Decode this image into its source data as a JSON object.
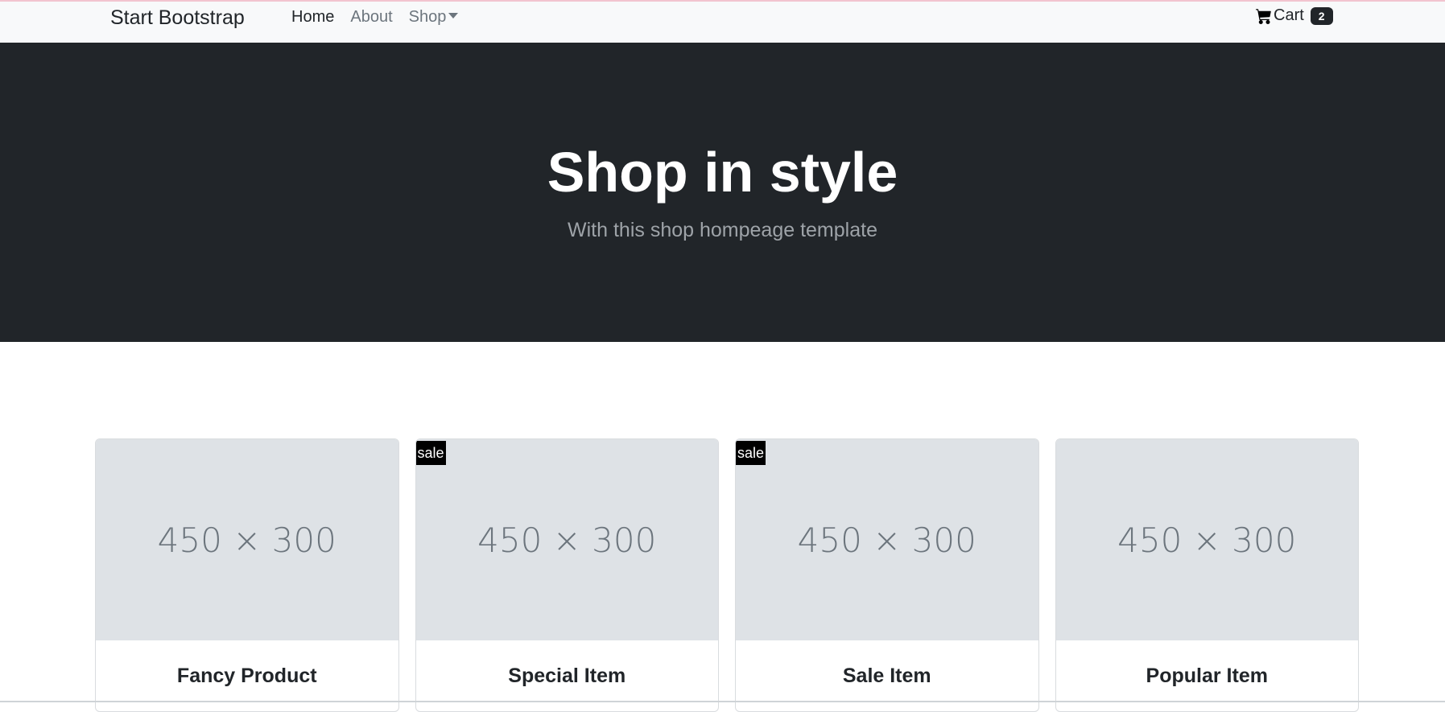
{
  "navbar": {
    "brand": "Start Bootstrap",
    "links": [
      {
        "label": "Home"
      },
      {
        "label": "About"
      },
      {
        "label": "Shop"
      }
    ],
    "cart": {
      "label": "Cart",
      "count": "2"
    }
  },
  "hero": {
    "title": "Shop in style",
    "subtitle": "With this shop hompeage template"
  },
  "products": [
    {
      "image_label": "450 × 300",
      "name": "Fancy Product"
    },
    {
      "image_label": "450 × 300",
      "name": "Special Item",
      "badge": "sale"
    },
    {
      "image_label": "450 × 300",
      "name": "Sale Item",
      "badge": "sale"
    },
    {
      "image_label": "450 × 300",
      "name": "Popular Item"
    }
  ],
  "colors": {
    "dark": "#212529",
    "navbar_bg": "#f8f9fa",
    "placeholder_bg": "#dee2e6"
  },
  "icons": {
    "cart": "cart-icon",
    "shop_dropdown": "caret-down-icon"
  }
}
